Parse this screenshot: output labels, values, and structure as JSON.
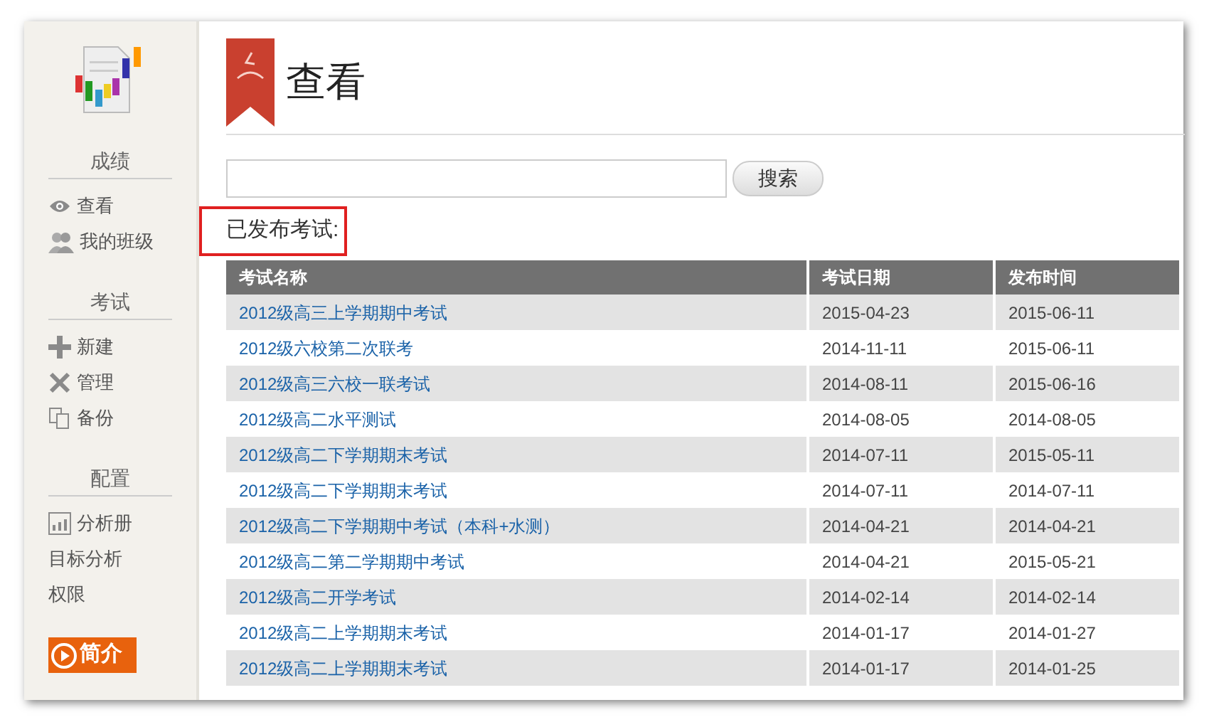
{
  "sidebar": {
    "sections": [
      {
        "title": "成绩",
        "items": [
          {
            "label": "查看",
            "kind": "eye"
          },
          {
            "label": "我的班级",
            "kind": "people"
          }
        ]
      },
      {
        "title": "考试",
        "items": [
          {
            "label": "新建",
            "kind": "plus"
          },
          {
            "label": "管理",
            "kind": "tools"
          },
          {
            "label": "备份",
            "kind": "copy"
          }
        ]
      },
      {
        "title": "配置",
        "items": [
          {
            "label": "分析册",
            "kind": "chart"
          },
          {
            "label": "目标分析",
            "kind": "text"
          },
          {
            "label": "权限",
            "kind": "text"
          }
        ]
      }
    ],
    "intro_button": "简介"
  },
  "page_title": "查看",
  "search": {
    "button": "搜索"
  },
  "section_label": "已发布考试:",
  "table": {
    "columns": [
      "考试名称",
      "考试日期",
      "发布时间"
    ],
    "rows": [
      [
        "2012级高三上学期期中考试",
        "2015-04-23",
        "2015-06-11"
      ],
      [
        "2012级六校第二次联考",
        "2014-11-11",
        "2015-06-11"
      ],
      [
        "2012级高三六校一联考试",
        "2014-08-11",
        "2015-06-16"
      ],
      [
        "2012级高二水平测试",
        "2014-08-05",
        "2014-08-05"
      ],
      [
        "2012级高二下学期期末考试",
        "2014-07-11",
        "2015-05-11"
      ],
      [
        "2012级高二下学期期末考试",
        "2014-07-11",
        "2014-07-11"
      ],
      [
        "2012级高二下学期期中考试（本科+水测）",
        "2014-04-21",
        "2014-04-21"
      ],
      [
        "2012级高二第二学期期中考试",
        "2014-04-21",
        "2015-05-21"
      ],
      [
        "2012级高二开学考试",
        "2014-02-14",
        "2014-02-14"
      ],
      [
        "2012级高二上学期期末考试",
        "2014-01-17",
        "2014-01-27"
      ],
      [
        "2012级高二上学期期末考试",
        "2014-01-17",
        "2014-01-25"
      ]
    ]
  }
}
